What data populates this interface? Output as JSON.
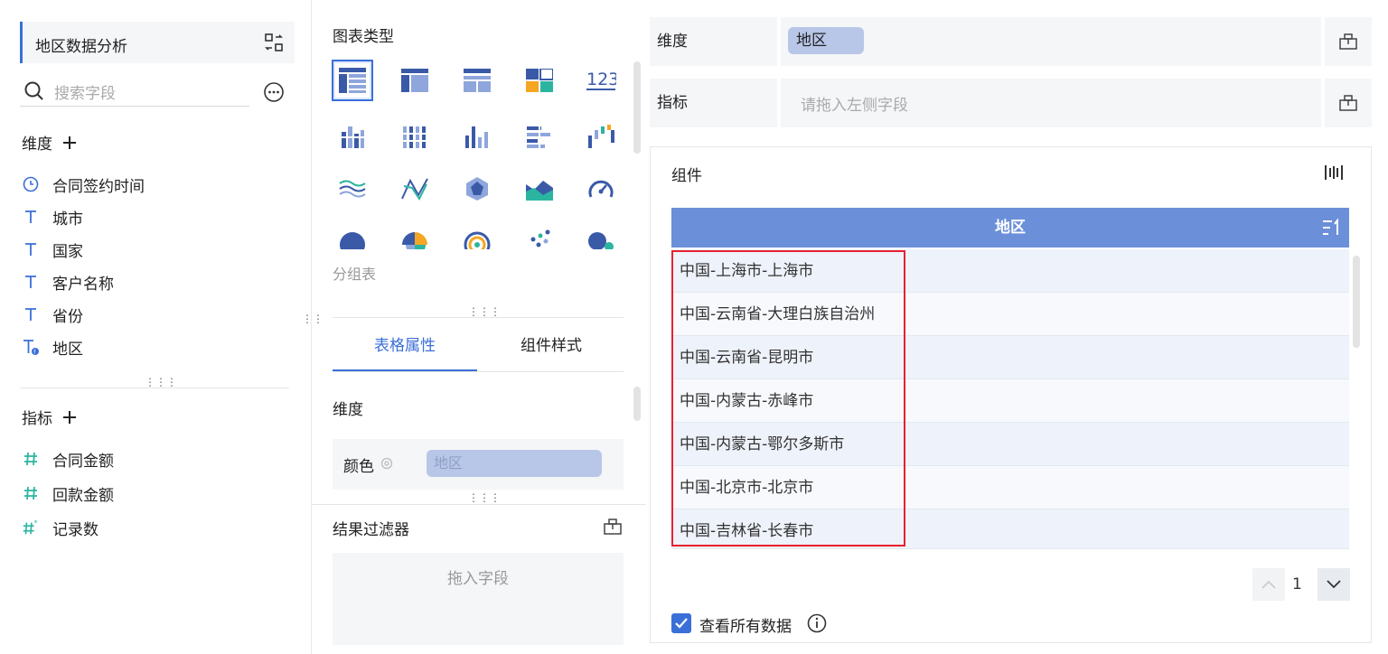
{
  "left": {
    "title": "地区数据分析",
    "search_placeholder": "搜索字段",
    "dimension_title": "维度",
    "dimensions": [
      {
        "icon": "clock-icon",
        "label": "合同签约时间"
      },
      {
        "icon": "text-type-icon",
        "label": "城市"
      },
      {
        "icon": "text-type-icon",
        "label": "国家"
      },
      {
        "icon": "text-type-icon",
        "label": "客户名称"
      },
      {
        "icon": "text-type-icon",
        "label": "省份"
      },
      {
        "icon": "text-formula-icon",
        "label": "地区"
      }
    ],
    "metric_title": "指标",
    "metrics": [
      {
        "icon": "hash-icon",
        "label": "合同金额"
      },
      {
        "icon": "hash-icon",
        "label": "回款金额"
      },
      {
        "icon": "hash-star-icon",
        "label": "记录数"
      }
    ]
  },
  "mid": {
    "chart_type_title": "图表类型",
    "selected_chart_name": "分组表",
    "tabs": [
      "表格属性",
      "组件样式"
    ],
    "dimension_title": "维度",
    "color_label": "颜色",
    "color_field": "地区",
    "filter_title": "结果过滤器",
    "drop_hint": "拖入字段"
  },
  "right": {
    "dim_label": "维度",
    "dim_field": "地区",
    "metric_label": "指标",
    "metric_placeholder": "请拖入左侧字段",
    "widget_title": "组件",
    "table_header": "地区",
    "rows": [
      "中国-上海市-上海市",
      "中国-云南省-大理白族自治州",
      "中国-云南省-昆明市",
      "中国-内蒙古-赤峰市",
      "中国-内蒙古-鄂尔多斯市",
      "中国-北京市-北京市",
      "中国-吉林省-长春市"
    ],
    "page_number": "1",
    "view_all_label": "查看所有数据"
  },
  "colors": {
    "accent": "#3a6fd8",
    "table_header": "#6b8fd9",
    "highlight": "#e8212f",
    "metric_icon": "#2bb5a0"
  }
}
